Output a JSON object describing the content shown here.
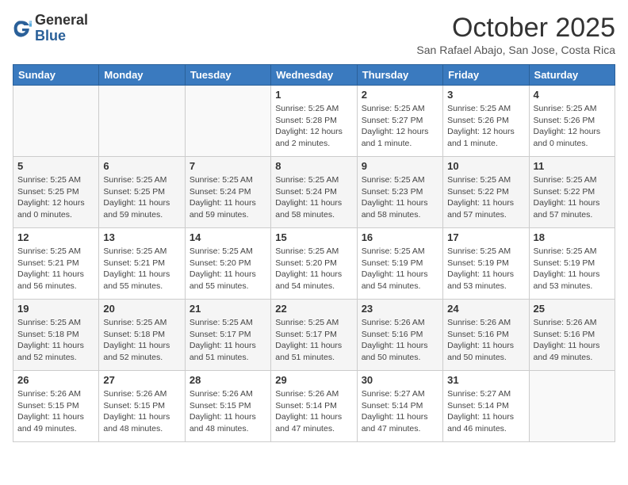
{
  "header": {
    "logo_line1": "General",
    "logo_line2": "Blue",
    "month_title": "October 2025",
    "subtitle": "San Rafael Abajo, San Jose, Costa Rica"
  },
  "weekdays": [
    "Sunday",
    "Monday",
    "Tuesday",
    "Wednesday",
    "Thursday",
    "Friday",
    "Saturday"
  ],
  "weeks": [
    [
      {
        "day": "",
        "info": ""
      },
      {
        "day": "",
        "info": ""
      },
      {
        "day": "",
        "info": ""
      },
      {
        "day": "1",
        "info": "Sunrise: 5:25 AM\nSunset: 5:28 PM\nDaylight: 12 hours\nand 2 minutes."
      },
      {
        "day": "2",
        "info": "Sunrise: 5:25 AM\nSunset: 5:27 PM\nDaylight: 12 hours\nand 1 minute."
      },
      {
        "day": "3",
        "info": "Sunrise: 5:25 AM\nSunset: 5:26 PM\nDaylight: 12 hours\nand 1 minute."
      },
      {
        "day": "4",
        "info": "Sunrise: 5:25 AM\nSunset: 5:26 PM\nDaylight: 12 hours\nand 0 minutes."
      }
    ],
    [
      {
        "day": "5",
        "info": "Sunrise: 5:25 AM\nSunset: 5:25 PM\nDaylight: 12 hours\nand 0 minutes."
      },
      {
        "day": "6",
        "info": "Sunrise: 5:25 AM\nSunset: 5:25 PM\nDaylight: 11 hours\nand 59 minutes."
      },
      {
        "day": "7",
        "info": "Sunrise: 5:25 AM\nSunset: 5:24 PM\nDaylight: 11 hours\nand 59 minutes."
      },
      {
        "day": "8",
        "info": "Sunrise: 5:25 AM\nSunset: 5:24 PM\nDaylight: 11 hours\nand 58 minutes."
      },
      {
        "day": "9",
        "info": "Sunrise: 5:25 AM\nSunset: 5:23 PM\nDaylight: 11 hours\nand 58 minutes."
      },
      {
        "day": "10",
        "info": "Sunrise: 5:25 AM\nSunset: 5:22 PM\nDaylight: 11 hours\nand 57 minutes."
      },
      {
        "day": "11",
        "info": "Sunrise: 5:25 AM\nSunset: 5:22 PM\nDaylight: 11 hours\nand 57 minutes."
      }
    ],
    [
      {
        "day": "12",
        "info": "Sunrise: 5:25 AM\nSunset: 5:21 PM\nDaylight: 11 hours\nand 56 minutes."
      },
      {
        "day": "13",
        "info": "Sunrise: 5:25 AM\nSunset: 5:21 PM\nDaylight: 11 hours\nand 55 minutes."
      },
      {
        "day": "14",
        "info": "Sunrise: 5:25 AM\nSunset: 5:20 PM\nDaylight: 11 hours\nand 55 minutes."
      },
      {
        "day": "15",
        "info": "Sunrise: 5:25 AM\nSunset: 5:20 PM\nDaylight: 11 hours\nand 54 minutes."
      },
      {
        "day": "16",
        "info": "Sunrise: 5:25 AM\nSunset: 5:19 PM\nDaylight: 11 hours\nand 54 minutes."
      },
      {
        "day": "17",
        "info": "Sunrise: 5:25 AM\nSunset: 5:19 PM\nDaylight: 11 hours\nand 53 minutes."
      },
      {
        "day": "18",
        "info": "Sunrise: 5:25 AM\nSunset: 5:19 PM\nDaylight: 11 hours\nand 53 minutes."
      }
    ],
    [
      {
        "day": "19",
        "info": "Sunrise: 5:25 AM\nSunset: 5:18 PM\nDaylight: 11 hours\nand 52 minutes."
      },
      {
        "day": "20",
        "info": "Sunrise: 5:25 AM\nSunset: 5:18 PM\nDaylight: 11 hours\nand 52 minutes."
      },
      {
        "day": "21",
        "info": "Sunrise: 5:25 AM\nSunset: 5:17 PM\nDaylight: 11 hours\nand 51 minutes."
      },
      {
        "day": "22",
        "info": "Sunrise: 5:25 AM\nSunset: 5:17 PM\nDaylight: 11 hours\nand 51 minutes."
      },
      {
        "day": "23",
        "info": "Sunrise: 5:26 AM\nSunset: 5:16 PM\nDaylight: 11 hours\nand 50 minutes."
      },
      {
        "day": "24",
        "info": "Sunrise: 5:26 AM\nSunset: 5:16 PM\nDaylight: 11 hours\nand 50 minutes."
      },
      {
        "day": "25",
        "info": "Sunrise: 5:26 AM\nSunset: 5:16 PM\nDaylight: 11 hours\nand 49 minutes."
      }
    ],
    [
      {
        "day": "26",
        "info": "Sunrise: 5:26 AM\nSunset: 5:15 PM\nDaylight: 11 hours\nand 49 minutes."
      },
      {
        "day": "27",
        "info": "Sunrise: 5:26 AM\nSunset: 5:15 PM\nDaylight: 11 hours\nand 48 minutes."
      },
      {
        "day": "28",
        "info": "Sunrise: 5:26 AM\nSunset: 5:15 PM\nDaylight: 11 hours\nand 48 minutes."
      },
      {
        "day": "29",
        "info": "Sunrise: 5:26 AM\nSunset: 5:14 PM\nDaylight: 11 hours\nand 47 minutes."
      },
      {
        "day": "30",
        "info": "Sunrise: 5:27 AM\nSunset: 5:14 PM\nDaylight: 11 hours\nand 47 minutes."
      },
      {
        "day": "31",
        "info": "Sunrise: 5:27 AM\nSunset: 5:14 PM\nDaylight: 11 hours\nand 46 minutes."
      },
      {
        "day": "",
        "info": ""
      }
    ]
  ]
}
